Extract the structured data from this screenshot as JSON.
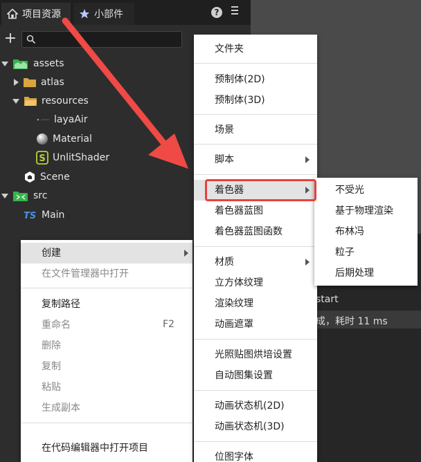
{
  "tabs": {
    "project": "项目资源",
    "widgets": "小部件"
  },
  "search": {
    "placeholder": ""
  },
  "tree": [
    {
      "label": "assets"
    },
    {
      "label": "atlas"
    },
    {
      "label": "resources"
    },
    {
      "label": "layaAir"
    },
    {
      "label": "Material"
    },
    {
      "label": "UnlitShader"
    },
    {
      "label": "Scene"
    },
    {
      "label": "src"
    },
    {
      "label": "Main"
    }
  ],
  "context_menu": {
    "create": "创建",
    "open_in_file_manager": "在文件管理器中打开",
    "copy_path": "复制路径",
    "rename": "重命名",
    "rename_shortcut": "F2",
    "delete": "删除",
    "copy": "复制",
    "paste": "粘贴",
    "duplicate": "生成副本",
    "open_in_code_editor": "在代码编辑器中打开项目"
  },
  "create_menu": {
    "folder": "文件夹",
    "prefab_2d": "预制体(2D)",
    "prefab_3d": "预制体(3D)",
    "scene": "场景",
    "script": "脚本",
    "shader": "着色器",
    "shader_blueprint": "着色器蓝图",
    "shader_blueprint_function": "着色器蓝图函数",
    "material": "材质",
    "cube_texture": "立方体纹理",
    "render_texture": "渲染纹理",
    "animation_mask": "动画遮罩",
    "lightmap_bake": "光照贴图烘培设置",
    "auto_atlas": "自动图集设置",
    "animator_2d": "动画状态机(2D)",
    "animator_3d": "动画状态机(3D)",
    "bitmap_font": "位图字体"
  },
  "shader_menu": {
    "unlit": "不受光",
    "pbr": "基于物理渲染",
    "blinn_phong": "布林冯",
    "particle": "粒子",
    "post_process": "后期处理"
  },
  "console": {
    "start": "start",
    "done": "成，耗时 11 ms"
  },
  "colors": {
    "highlight_box": "#e8413b",
    "pointer_arrow": "#ef4a45",
    "folder": "#d9a53f",
    "assets_icon": "#37b24d",
    "ts_icon": "#4a90e2"
  },
  "icons": {
    "home": "home-icon",
    "star": "star-icon",
    "help": "help-icon",
    "more": "more-icon",
    "search": "search-icon",
    "add": "plus-icon"
  }
}
